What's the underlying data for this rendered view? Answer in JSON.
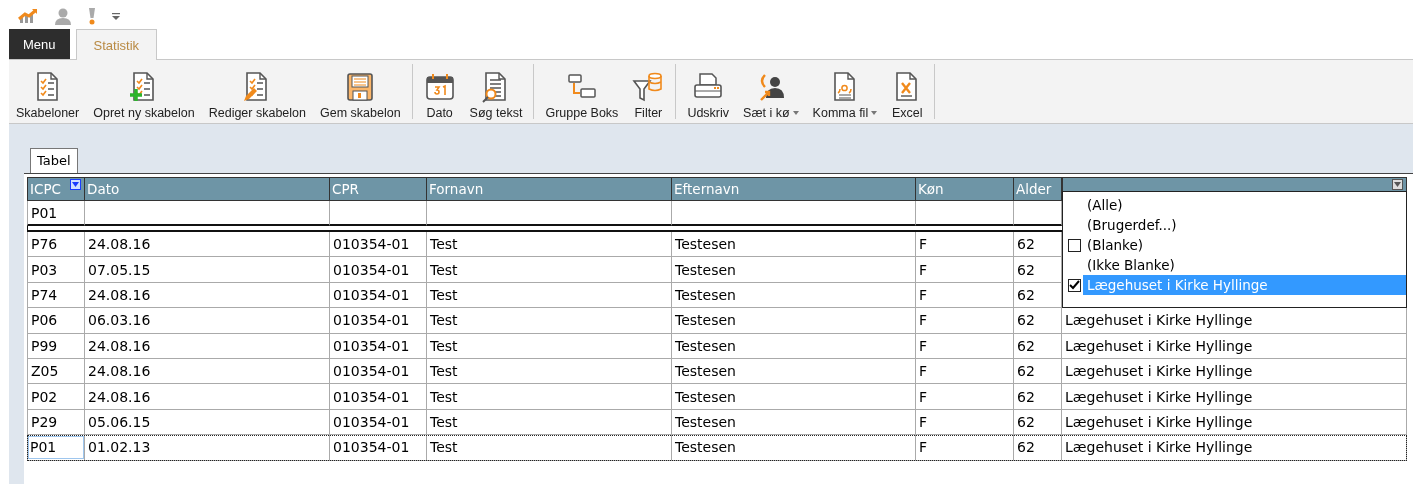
{
  "quick_access": [
    {
      "kind": "chart"
    },
    {
      "kind": "person"
    },
    {
      "kind": "alert"
    },
    {
      "kind": "customize"
    }
  ],
  "ribbon_tabs": [
    {
      "label": "Menu",
      "kind": "menu",
      "selected": false
    },
    {
      "label": "Statistik",
      "kind": "tab",
      "selected": true
    }
  ],
  "toolbar_groups": [
    [
      {
        "label": "Skabeloner",
        "kind": "checklist"
      },
      {
        "label": "Opret ny skabelon",
        "kind": "add"
      },
      {
        "label": "Rediger skabelon",
        "kind": "edit"
      },
      {
        "label": "Gem skabelon",
        "kind": "save"
      }
    ],
    [
      {
        "label": "Dato",
        "kind": "date"
      },
      {
        "label": "Søg tekst",
        "kind": "search"
      }
    ],
    [
      {
        "label": "Gruppe Boks",
        "kind": "group"
      },
      {
        "label": "Filter",
        "kind": "filter"
      }
    ],
    [
      {
        "label": "Udskriv",
        "kind": "print"
      },
      {
        "label": "Sæt i kø",
        "kind": "queue",
        "has_menu": true
      },
      {
        "label": "Komma fil",
        "kind": "csv",
        "has_menu": true
      },
      {
        "label": "Excel",
        "kind": "excel"
      }
    ]
  ],
  "view_tabs": [
    {
      "label": "Tabel",
      "selected": true
    }
  ],
  "table": {
    "columns": [
      {
        "label": "ICPC",
        "filter_active": true
      },
      {
        "label": "Dato"
      },
      {
        "label": "CPR"
      },
      {
        "label": "Fornavn"
      },
      {
        "label": "Efternavn"
      },
      {
        "label": "Køn"
      },
      {
        "label": "Alder"
      },
      {
        "filter_active": false
      }
    ],
    "filter_row": [
      "P01"
    ],
    "rows": [
      {
        "cells": [
          "P76",
          "24.08.16",
          "010354-01",
          "Test",
          "Testesen",
          "F",
          "62",
          ""
        ],
        "selected": false
      },
      {
        "cells": [
          "P03",
          "07.05.15",
          "010354-01",
          "Test",
          "Testesen",
          "F",
          "62",
          ""
        ],
        "selected": false
      },
      {
        "cells": [
          "P74",
          "24.08.16",
          "010354-01",
          "Test",
          "Testesen",
          "F",
          "62",
          ""
        ],
        "selected": false
      },
      {
        "cells": [
          "P06",
          "06.03.16",
          "010354-01",
          "Test",
          "Testesen",
          "F",
          "62",
          "Lægehuset i Kirke Hyllinge"
        ],
        "selected": false
      },
      {
        "cells": [
          "P99",
          "24.08.16",
          "010354-01",
          "Test",
          "Testesen",
          "F",
          "62",
          "Lægehuset i Kirke Hyllinge"
        ],
        "selected": false
      },
      {
        "cells": [
          "Z05",
          "24.08.16",
          "010354-01",
          "Test",
          "Testesen",
          "F",
          "62",
          "Lægehuset i Kirke Hyllinge"
        ],
        "selected": false
      },
      {
        "cells": [
          "P02",
          "24.08.16",
          "010354-01",
          "Test",
          "Testesen",
          "F",
          "62",
          "Lægehuset i Kirke Hyllinge"
        ],
        "selected": false
      },
      {
        "cells": [
          "P29",
          "05.06.15",
          "010354-01",
          "Test",
          "Testesen",
          "F",
          "62",
          "Lægehuset i Kirke Hyllinge"
        ],
        "selected": false
      },
      {
        "cells": [
          "P01",
          "01.02.13",
          "010354-01",
          "Test",
          "Testesen",
          "F",
          "62",
          "Lægehuset i Kirke Hyllinge"
        ],
        "selected": true
      }
    ]
  },
  "filter_dropdown": {
    "items": [
      {
        "label": "(Alle)",
        "kind": "plain",
        "selected": false
      },
      {
        "label": "(Brugerdef...)",
        "kind": "plain",
        "selected": false
      },
      {
        "label": "(Blanke)",
        "kind": "checkbox",
        "checked": false,
        "selected": false
      },
      {
        "label": "(Ikke Blanke)",
        "kind": "plain",
        "selected": false
      },
      {
        "label": "Lægehuset i Kirke Hyllinge",
        "kind": "checkbox",
        "checked": true,
        "selected": true
      }
    ]
  }
}
